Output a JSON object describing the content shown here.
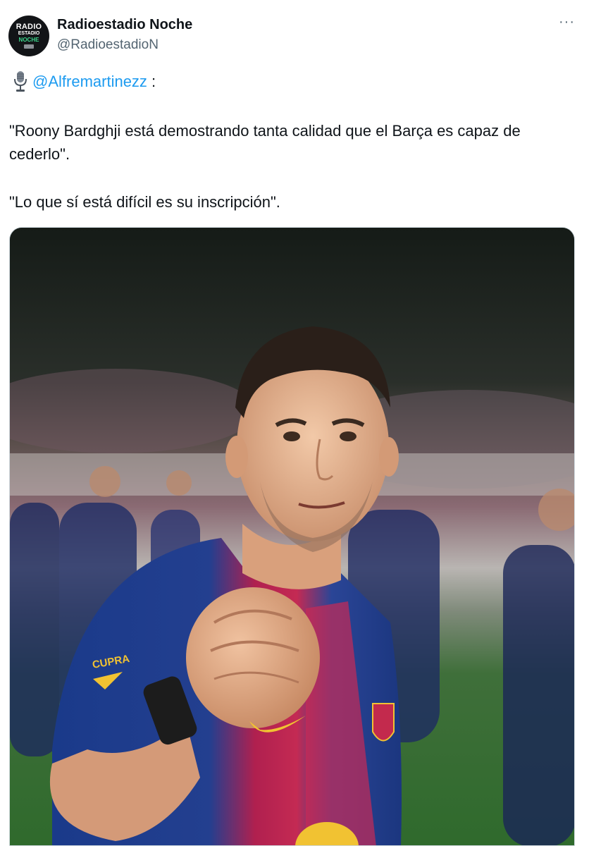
{
  "account": {
    "display_name": "Radioestadio Noche",
    "handle": "@RadioestadioN",
    "avatar_text": [
      "RADIO",
      "ESTADIO",
      "NOCHE"
    ]
  },
  "tweet": {
    "mention": "@Alfremartinezz",
    "colon": ":",
    "quote_1": "\"Roony Bardghji está demostrando tanta calidad que el Barça es capaz de cederlo\".",
    "quote_2": "\"Lo que sí está difícil es su inscripción\".",
    "more_label": "···"
  },
  "media": {
    "description_icon": "photo",
    "sponsor_text": "CUPRA"
  },
  "colors": {
    "link": "#1d9bf0",
    "text": "#0f1419",
    "muted": "#536471"
  }
}
